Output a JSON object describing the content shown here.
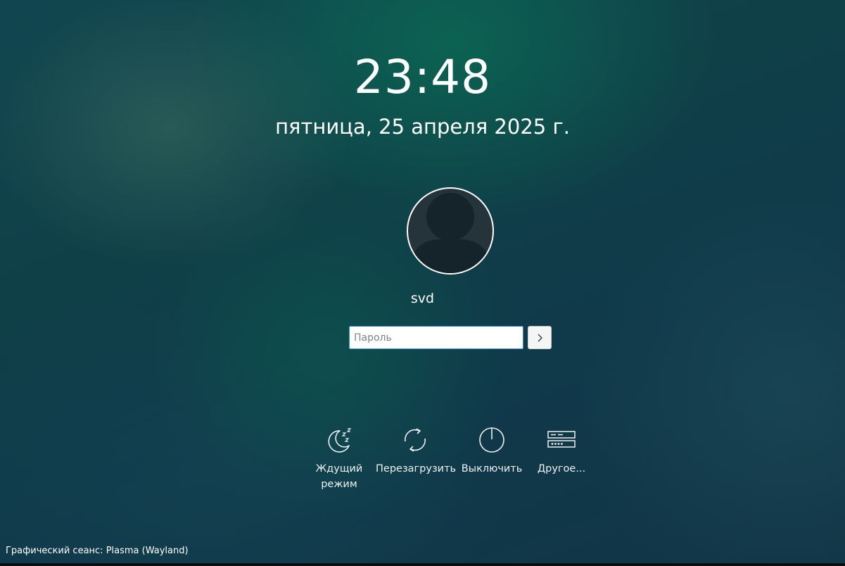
{
  "clock": {
    "time": "23:48",
    "date": "пятница, 25 апреля 2025 г."
  },
  "user": {
    "name": "svd"
  },
  "login": {
    "password_placeholder": "Пароль",
    "submit_icon": "chevron-right-icon"
  },
  "actions": [
    {
      "label": "Ждущий режим",
      "icon": "sleep-moon-icon"
    },
    {
      "label": "Перезагрузить",
      "icon": "restart-icon"
    },
    {
      "label": "Выключить",
      "icon": "power-icon"
    },
    {
      "label": "Другое...",
      "icon": "other-options-icon"
    }
  ],
  "footer": {
    "session": "Графический сеанс: Plasma (Wayland)"
  },
  "colors": {
    "accent": "#3d8ee0",
    "text": "#ffffff",
    "background": "#10404a"
  }
}
